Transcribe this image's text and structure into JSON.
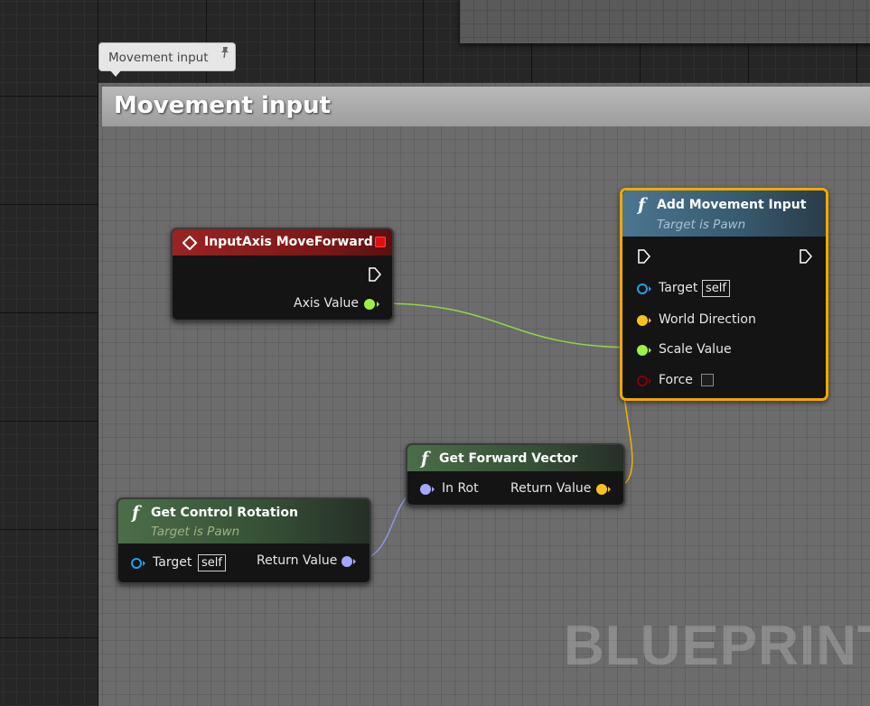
{
  "comment": {
    "bubble_text": "Movement input",
    "header_title": "Movement input"
  },
  "watermark": "BLUEPRINT",
  "nodes": {
    "input_axis": {
      "title": "InputAxis MoveForward",
      "output_label": "Axis Value",
      "header_color": "#8a1f1f"
    },
    "add_movement": {
      "title": "Add Movement Input",
      "subtitle": "Target is Pawn",
      "target_label": "Target",
      "target_value": "self",
      "world_direction_label": "World Direction",
      "scale_value_label": "Scale Value",
      "force_label": "Force",
      "force_checked": false,
      "header_color": "#3f6378",
      "selected": true
    },
    "get_forward": {
      "title": "Get Forward Vector",
      "input_label": "In Rot",
      "output_label": "Return Value",
      "header_color": "#3b5a3b"
    },
    "get_control": {
      "title": "Get Control Rotation",
      "subtitle": "Target is Pawn",
      "target_label": "Target",
      "target_value": "self",
      "output_label": "Return Value",
      "header_color": "#3b5a3b"
    }
  },
  "pin_colors": {
    "float": "#9cf04a",
    "vector": "#f7c21b",
    "rotator": "#a3a8ff",
    "object": "#1fa3e8",
    "bool": "#8a0000",
    "exec": "#ffffff"
  },
  "icons": {
    "event": "diamond-icon",
    "function": "function-f-icon",
    "pin": "pin-icon"
  }
}
